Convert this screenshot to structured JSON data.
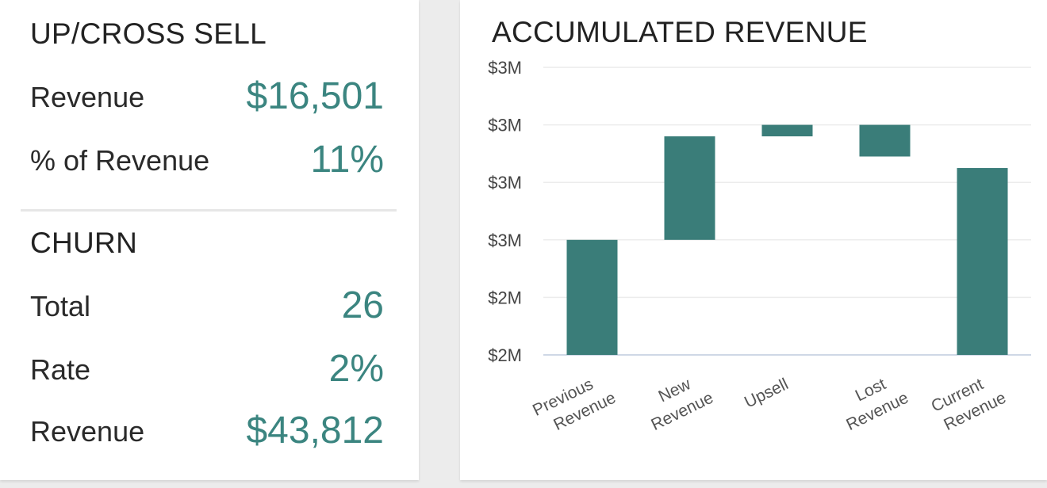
{
  "upcross": {
    "title": "UP/CROSS SELL",
    "rows": [
      {
        "label": "Revenue",
        "value": "$16,501"
      },
      {
        "label": "% of Revenue",
        "value": "11%"
      }
    ]
  },
  "churn": {
    "title": "CHURN",
    "rows": [
      {
        "label": "Total",
        "value": "26"
      },
      {
        "label": "Rate",
        "value": "2%"
      },
      {
        "label": "Revenue",
        "value": "$43,812"
      }
    ]
  },
  "colors": {
    "accent": "#3b8580",
    "bar": "#3a7d79",
    "grid": "#ececec",
    "axis": "#cfd8e6"
  },
  "chart_data": {
    "type": "bar",
    "subtype": "waterfall",
    "title": "ACCUMULATED REVENUE",
    "xlabel": "",
    "ylabel": "",
    "y_tick_labels": [
      "$2M",
      "$2M",
      "$3M",
      "$3M",
      "$3M",
      "$3M"
    ],
    "ylim": [
      2.0,
      3.0
    ],
    "grid": true,
    "categories": [
      [
        "Previous",
        "Revenue"
      ],
      [
        "New",
        "Revenue"
      ],
      [
        "Upsell"
      ],
      [
        "Lost",
        "Revenue"
      ],
      [
        "Current",
        "Revenue"
      ]
    ],
    "bars": [
      {
        "start": 2.0,
        "end": 2.4
      },
      {
        "start": 2.4,
        "end": 2.76
      },
      {
        "start": 2.76,
        "end": 2.8
      },
      {
        "start": 2.8,
        "end": 2.69
      },
      {
        "start": 2.0,
        "end": 2.65
      }
    ]
  }
}
